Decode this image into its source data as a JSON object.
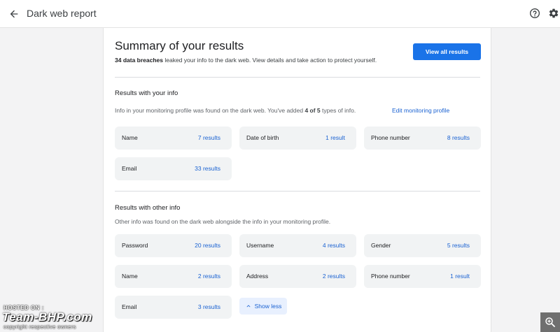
{
  "header": {
    "title": "Dark web report",
    "icons": {
      "back": "arrow-back-icon",
      "help": "help-circle-icon",
      "settings": "gear-icon"
    }
  },
  "summary": {
    "title": "Summary of your results",
    "breach_count": "34 data breaches",
    "text_rest": " leaked your info to the dark web. View details and take action to protect yourself.",
    "view_all_label": "View all results"
  },
  "your_info": {
    "title": "Results with your info",
    "desc_prefix": "Info in your monitoring profile was found on the dark web. You've added ",
    "desc_count": "4 of 5",
    "desc_suffix": " types of info.",
    "edit_label": "Edit monitoring profile",
    "items": [
      {
        "label": "Name",
        "count": "7 results"
      },
      {
        "label": "Date of birth",
        "count": "1 result"
      },
      {
        "label": "Phone number",
        "count": "8 results"
      },
      {
        "label": "Email",
        "count": "33 results"
      }
    ]
  },
  "other_info": {
    "title": "Results with other info",
    "desc": "Other info was found on the dark web alongside the info in your monitoring profile.",
    "items": [
      {
        "label": "Password",
        "count": "20 results"
      },
      {
        "label": "Username",
        "count": "4 results"
      },
      {
        "label": "Gender",
        "count": "5 results"
      },
      {
        "label": "Name",
        "count": "2 results"
      },
      {
        "label": "Address",
        "count": "2 results"
      },
      {
        "label": "Phone number",
        "count": "1 result"
      },
      {
        "label": "Email",
        "count": "3 results"
      }
    ],
    "show_less_label": "Show less"
  },
  "watermark": {
    "hosted_on": "HOSTED ON :",
    "brand": "Team-BHP.com",
    "copyright": "copyright respective owners"
  },
  "colors": {
    "accent": "#1a73e8",
    "link": "#1a62d2",
    "tile_bg": "#f1f3f4"
  }
}
